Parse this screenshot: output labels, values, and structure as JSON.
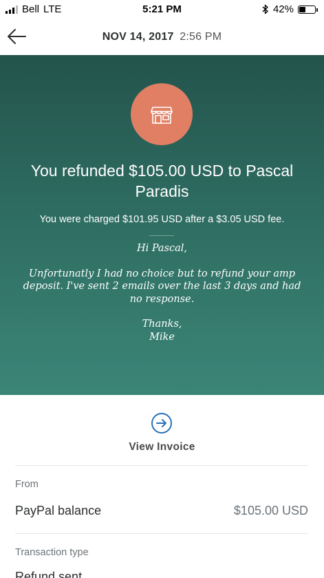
{
  "status_bar": {
    "carrier": "Bell",
    "network": "LTE",
    "time": "5:21 PM",
    "battery": "42%",
    "battery_level": 0.42,
    "bluetooth_icon": "bluetooth-icon"
  },
  "header": {
    "date": "NOV 14, 2017",
    "time": "2:56 PM",
    "back_icon": "arrow-left-icon"
  },
  "hero": {
    "avatar_icon": "storefront-icon",
    "title": "You refunded $105.00 USD to Pascal Paradis",
    "fee_text": "You were charged $101.95 USD after a $3.05 USD fee.",
    "note": {
      "greeting": "Hi Pascal,",
      "body": "Unfortunatly I had no choice but to refund your amp deposit. I've sent 2 emails over the last 3 days and had no response.",
      "closing": "Thanks,",
      "signature": "Mike"
    },
    "colors": {
      "gradient_top": "#23544c",
      "gradient_bottom": "#3b8577",
      "avatar": "#e07f63"
    }
  },
  "invoice": {
    "icon": "arrow-right-circle-icon",
    "label": "View Invoice",
    "icon_color": "#2a6fb5"
  },
  "details": {
    "from_label": "From",
    "from_value": "PayPal balance",
    "from_amount": "$105.00 USD",
    "type_label": "Transaction type",
    "type_value": "Refund sent"
  }
}
